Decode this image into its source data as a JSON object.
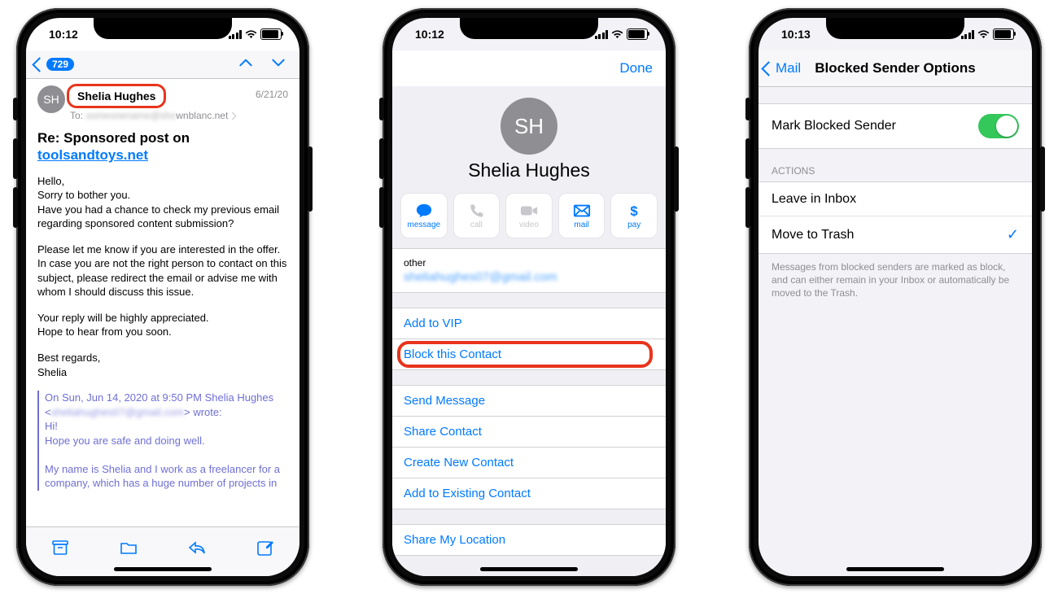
{
  "phone1": {
    "status_time": "10:12",
    "nav": {
      "badge": "729"
    },
    "sender": {
      "initials": "SH",
      "name": "Shelia Hughes"
    },
    "to_line_suffix": "wnblanc.net",
    "date": "6/21/20",
    "subject_prefix": "Re: Sponsored post on ",
    "subject_link": "toolsandtoys.net",
    "body_p1": "Hello,\nSorry to bother you.\nHave you had a chance to check my previous email regarding sponsored content submission?",
    "body_p2": "Please let me know if you are interested in the offer.\nIn case you are not the right person to contact on this subject, please redirect the email or advise me with whom I should discuss this issue.",
    "body_p3": "Your reply will be highly appreciated.\nHope to hear from you soon.",
    "body_p4": "Best regards,\nShelia",
    "quote_l1_prefix": "On Sun, Jun 14, 2020 at 9:50 PM Shelia Hughes <",
    "quote_l1_blur": "sheliahughes07@gmail.com",
    "quote_l1_suffix": "> wrote:",
    "quote_l2": "Hi!",
    "quote_l3": "Hope you are safe and doing well.",
    "quote_l4": "My name is Shelia and I work as a freelancer for a company, which has a huge number of projects in"
  },
  "phone2": {
    "status_time": "10:12",
    "done": "Done",
    "avatar_initials": "SH",
    "name": "Shelia Hughes",
    "actions": {
      "message": "message",
      "call": "call",
      "video": "video",
      "mail": "mail",
      "pay": "pay"
    },
    "other_label": "other",
    "other_value_blur": "sheliahughes07@gmail.com",
    "rows": {
      "vip": "Add to VIP",
      "block": "Block this Contact",
      "send": "Send Message",
      "share": "Share Contact",
      "create": "Create New Contact",
      "existing": "Add to Existing Contact",
      "location": "Share My Location"
    }
  },
  "phone3": {
    "status_time": "10:13",
    "back_label": "Mail",
    "title": "Blocked Sender Options",
    "mark_label": "Mark Blocked Sender",
    "actions_header": "ACTIONS",
    "leave": "Leave in Inbox",
    "trash": "Move to Trash",
    "footer": "Messages from blocked senders are marked as block, and can either remain in your Inbox or automatically be moved to the Trash."
  }
}
